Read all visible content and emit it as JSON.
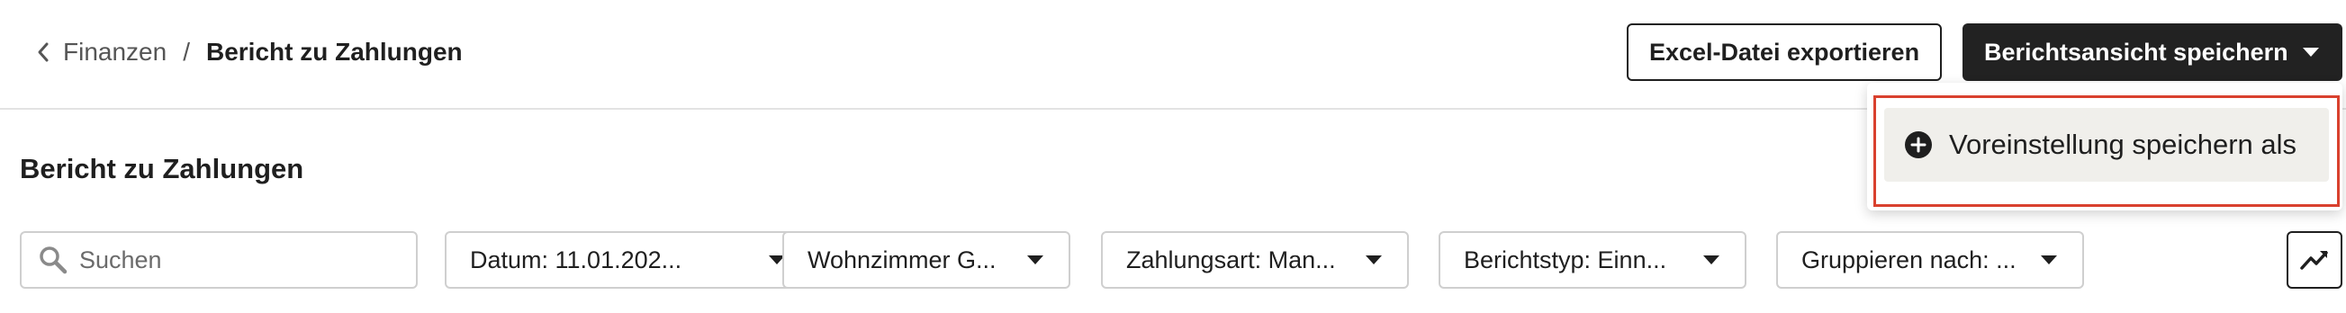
{
  "breadcrumb": {
    "parent": "Finanzen",
    "separator": "/",
    "current": "Bericht zu Zahlungen"
  },
  "header": {
    "export_label": "Excel-Datei exportieren",
    "save_view_label": "Berichtsansicht speichern"
  },
  "save_menu": {
    "items": [
      {
        "label": "Voreinstellung speichern als",
        "icon": "plus-circle-icon"
      }
    ]
  },
  "page": {
    "title": "Bericht zu Zahlungen"
  },
  "search": {
    "placeholder": "Suchen",
    "value": ""
  },
  "filters": [
    {
      "label": "Datum: 11.01.202..."
    },
    {
      "label": "Wohnzimmer G..."
    },
    {
      "label": "Zahlungsart: Man..."
    },
    {
      "label": "Berichtstyp: Einn..."
    },
    {
      "label": "Gruppieren nach: ..."
    }
  ],
  "trend_button": {
    "icon": "trending-up-icon"
  },
  "colors": {
    "primary_dark": "#222222",
    "highlight_border": "#d9412e",
    "menu_item_bg": "#f0efeb"
  }
}
